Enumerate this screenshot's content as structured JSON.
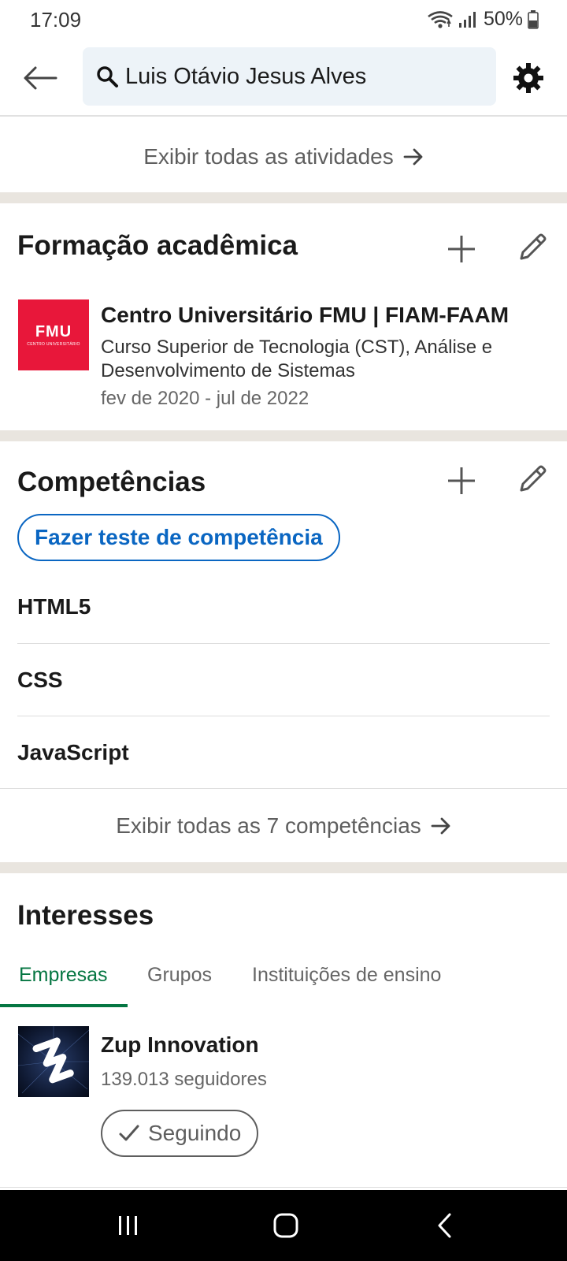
{
  "status_bar": {
    "time": "17:09",
    "battery": "50%"
  },
  "header": {
    "search_value": "Luis Otávio Jesus Alves"
  },
  "activity": {
    "show_all_label": "Exibir todas as atividades"
  },
  "education": {
    "title": "Formação acadêmica",
    "logo_text": "FMU",
    "logo_subtext": "CENTRO UNIVERSITÁRIO",
    "school": "Centro Universitário FMU | FIAM-FAAM",
    "degree": "Curso Superior de Tecnologia (CST), Análise e Desenvolvimento de Sistemas",
    "dates": "fev de 2020 - jul de 2022"
  },
  "skills": {
    "title": "Competências",
    "test_button": "Fazer teste de competência",
    "items": [
      "HTML5",
      "CSS",
      "JavaScript"
    ],
    "show_all_label": "Exibir todas as 7 competências"
  },
  "interests": {
    "title": "Interesses",
    "tabs": [
      "Empresas",
      "Grupos",
      "Instituições de ensino"
    ],
    "active_tab": "Empresas",
    "company": {
      "name": "Zup Innovation",
      "followers": "139.013 seguidores",
      "follow_button": "Seguindo"
    }
  },
  "colors": {
    "accent_blue": "#0a66c2",
    "active_tab_green": "#057642",
    "fmu_red": "#e8173a",
    "band": "#e9e5df"
  },
  "icons": [
    "back-arrow-icon",
    "search-icon",
    "gear-icon",
    "plus-icon",
    "pencil-icon",
    "arrow-right-icon",
    "checkmark-icon",
    "wifi-icon",
    "signal-icon",
    "battery-icon",
    "recents-icon",
    "home-icon",
    "back-chevron-icon"
  ]
}
